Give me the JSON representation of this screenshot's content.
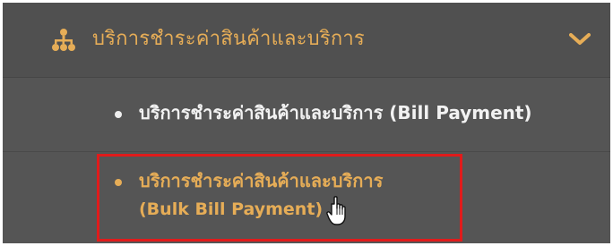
{
  "menu": {
    "header": {
      "icon": "sitemap-icon",
      "label": "บริการชำระค่าสินค้าและบริการ",
      "toggle_icon": "chevron-down-icon"
    },
    "items": [
      {
        "label": "บริการชำระค่าสินค้าและบริการ (Bill Payment)",
        "active": false
      },
      {
        "label_line1": "บริการชำระค่าสินค้าและบริการ",
        "label_line2": "(Bulk Bill Payment)",
        "active": true
      }
    ]
  },
  "annotation": {
    "highlight_color": "#e01b1b",
    "cursor_icon": "hand-pointer-icon"
  },
  "colors": {
    "panel_bg": "#555555",
    "accent": "#e6ad57",
    "item_text": "#f2f2f2"
  }
}
